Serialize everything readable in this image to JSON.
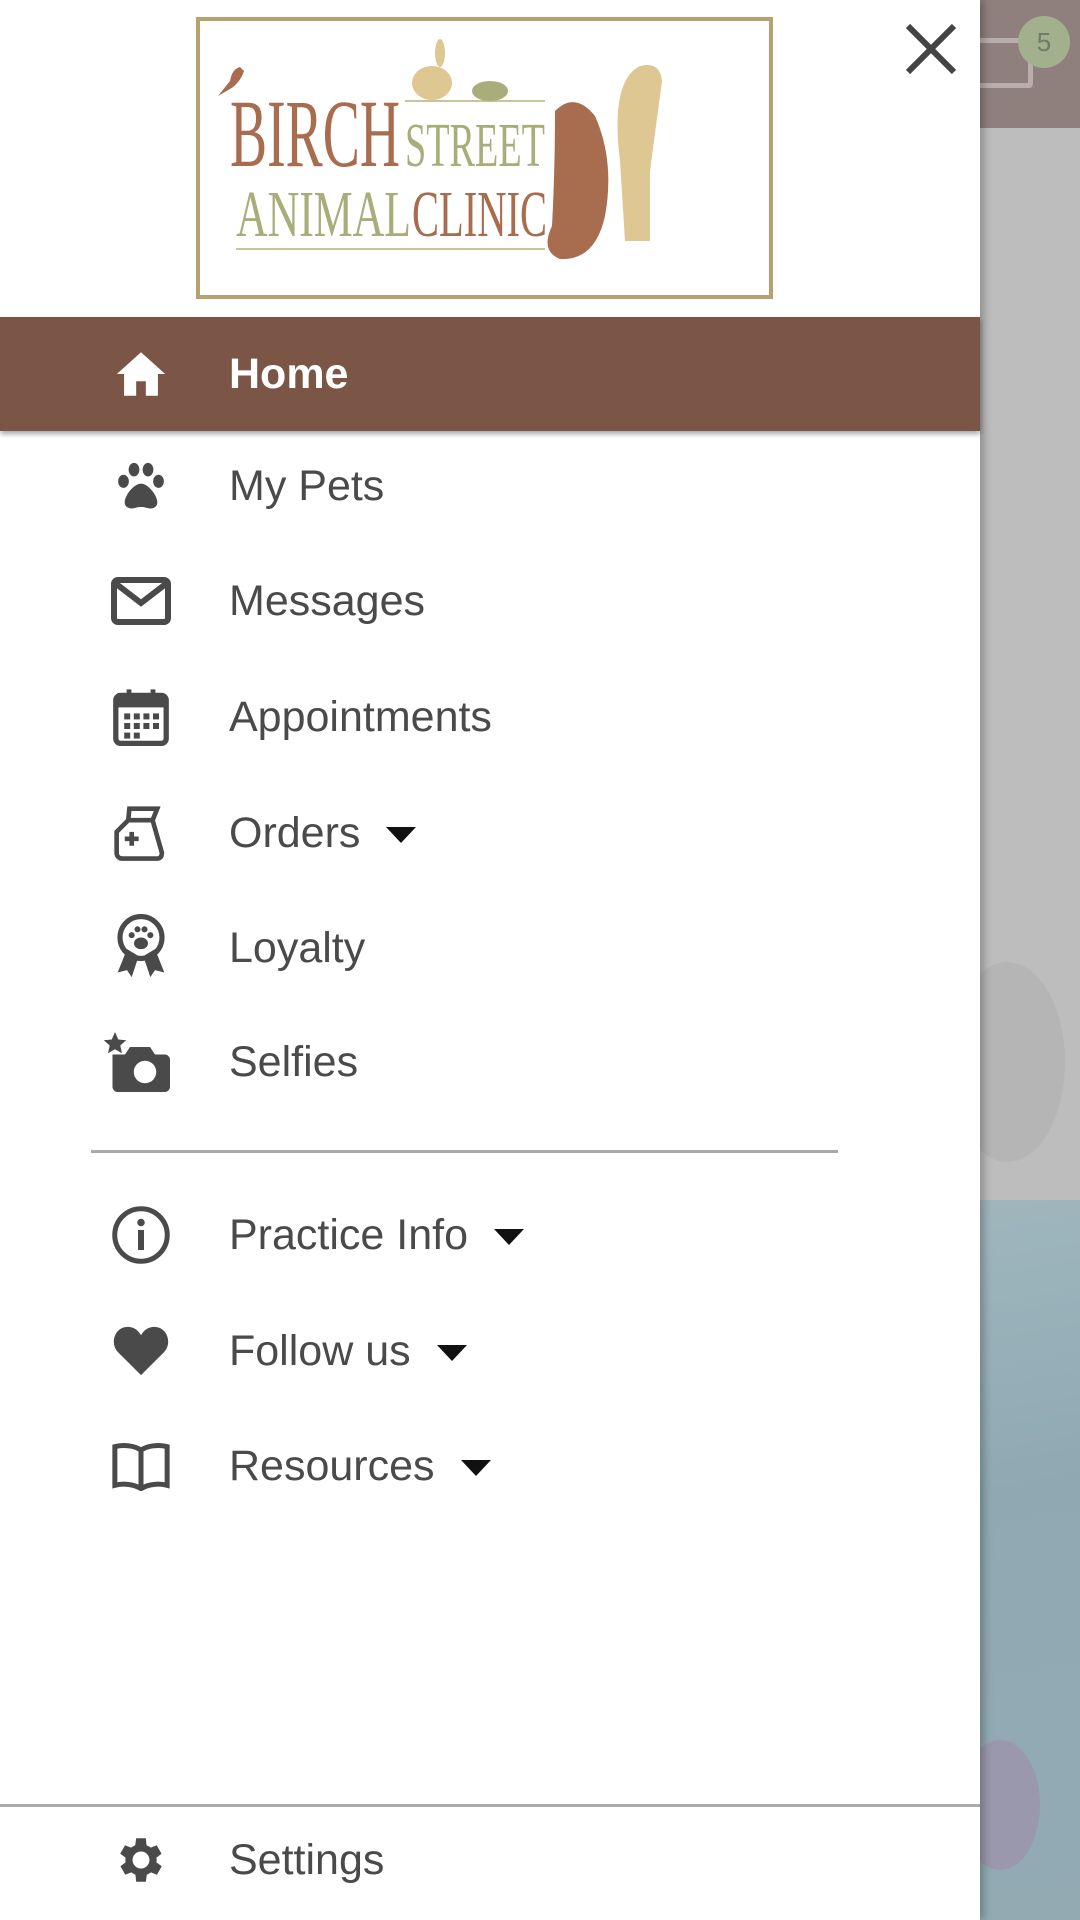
{
  "background": {
    "mail_badge_count": "5"
  },
  "drawer": {
    "logo": {
      "line1a": "BIRCH",
      "line1b": "STREET",
      "line2a": "ANIMAL",
      "line2b": "CLINIC"
    },
    "items": [
      {
        "label": "Home",
        "icon": "home-icon",
        "active": true
      },
      {
        "label": "My Pets",
        "icon": "paw-icon"
      },
      {
        "label": "Messages",
        "icon": "envelope-icon"
      },
      {
        "label": "Appointments",
        "icon": "calendar-icon"
      },
      {
        "label": "Orders",
        "icon": "pet-food-bag-icon",
        "dropdown": true
      },
      {
        "label": "Loyalty",
        "icon": "award-ribbon-icon"
      },
      {
        "label": "Selfies",
        "icon": "camera-star-icon"
      }
    ],
    "secondary": [
      {
        "label": "Practice Info",
        "icon": "info-circle-icon",
        "dropdown": true
      },
      {
        "label": "Follow us",
        "icon": "heart-icon",
        "dropdown": true
      },
      {
        "label": "Resources",
        "icon": "book-icon",
        "dropdown": true
      }
    ],
    "settings": {
      "label": "Settings",
      "icon": "gear-icon"
    }
  },
  "colors": {
    "active_bg": "#7b5646",
    "icon": "#4a4a4a",
    "logo_brown": "#a86c4f",
    "logo_green": "#a8ad7a",
    "logo_tan": "#dfc793"
  }
}
